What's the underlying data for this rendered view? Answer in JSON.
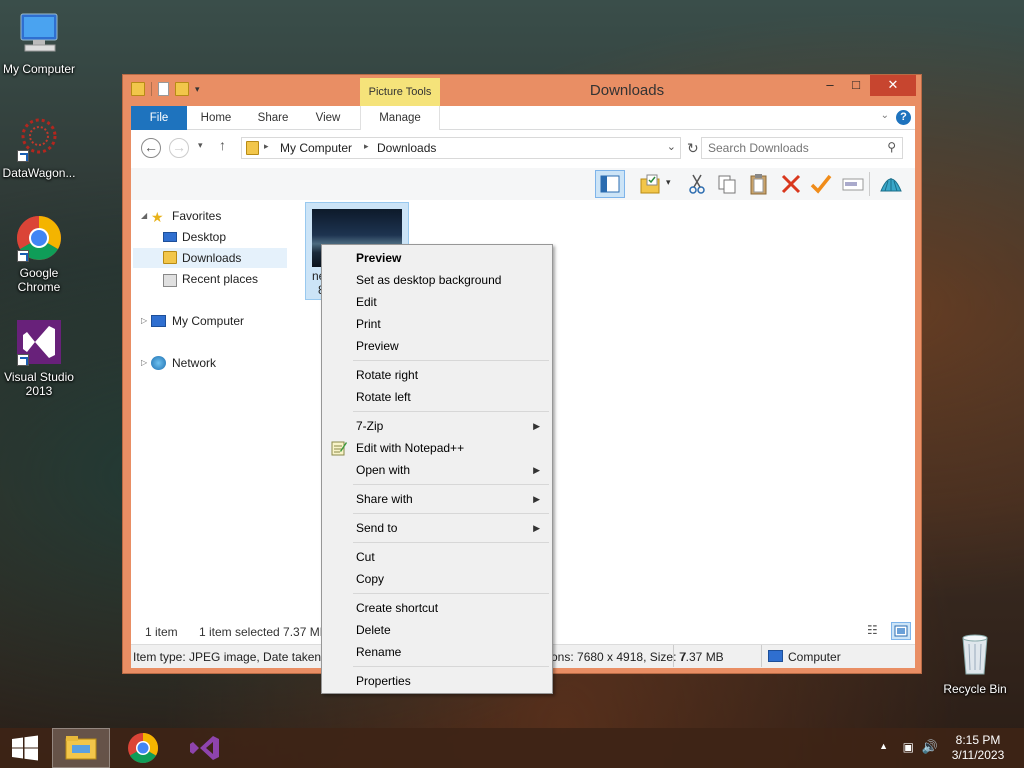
{
  "desktop": {
    "icons": [
      {
        "label": "My Computer"
      },
      {
        "label": "DataWagon..."
      },
      {
        "label": "Google Chrome"
      },
      {
        "label": "Visual Studio 2013"
      },
      {
        "label": "Recycle Bin"
      }
    ]
  },
  "window": {
    "title": "Downloads",
    "context_tab": "Picture Tools",
    "tabs": [
      {
        "label": "File"
      },
      {
        "label": "Home"
      },
      {
        "label": "Share"
      },
      {
        "label": "View"
      },
      {
        "label": "Manage"
      }
    ],
    "address": {
      "crumbs": [
        "My Computer",
        "Downloads"
      ]
    },
    "search": {
      "placeholder": "Search Downloads"
    },
    "nav_pane": {
      "favorites": "Favorites",
      "items": [
        "Desktop",
        "Downloads",
        "Recent places"
      ],
      "computer": "My Computer",
      "network": "Network"
    },
    "file": {
      "name_partial": "ne",
      "size_partial": "8"
    },
    "status": {
      "count": "1 item",
      "selected": "1 item selected 7.37 MB"
    },
    "details": {
      "left": "Item type: JPEG image, Date taken: 2",
      "middle": "ons: 7680 x 4918, Size: 7",
      "size": "7.37 MB",
      "location": "Computer"
    }
  },
  "context_menu": {
    "items": [
      {
        "label": "Preview",
        "bold": true
      },
      {
        "label": "Set as desktop background"
      },
      {
        "label": "Edit"
      },
      {
        "label": "Print"
      },
      {
        "label": "Preview"
      },
      {
        "label": "Rotate right"
      },
      {
        "label": "Rotate left"
      },
      {
        "label": "7-Zip",
        "submenu": true
      },
      {
        "label": "Edit with Notepad++"
      },
      {
        "label": "Open with",
        "submenu": true
      },
      {
        "label": "Share with",
        "submenu": true
      },
      {
        "label": "Send to",
        "submenu": true
      },
      {
        "label": "Cut"
      },
      {
        "label": "Copy"
      },
      {
        "label": "Create shortcut"
      },
      {
        "label": "Delete"
      },
      {
        "label": "Rename"
      },
      {
        "label": "Properties"
      }
    ]
  },
  "taskbar": {
    "time": "8:15 PM",
    "date": "3/11/2023"
  },
  "colors": {
    "window_frame": "#e98e64",
    "file_tab": "#1e73be",
    "picture_tools": "#f5e37a",
    "selection": "#cce4f7"
  }
}
